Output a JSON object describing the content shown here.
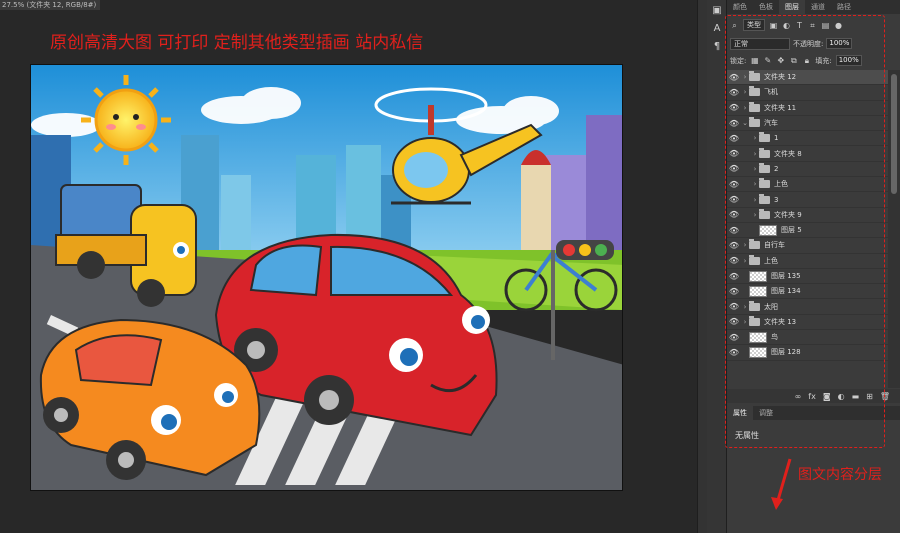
{
  "document": {
    "tab_title": "27.5% (文件夹 12, RGB/8#)"
  },
  "canvas": {
    "headline": "原创高清大图 可打印  定制其他类型插画 站内私信"
  },
  "panel": {
    "tabs": [
      "颜色",
      "色板",
      "图层",
      "通道",
      "路径"
    ],
    "active_tab": "图层",
    "filter": {
      "kind_label": "类型"
    },
    "blend": {
      "mode": "正常",
      "opacity_label": "不透明度:",
      "opacity_value": "100%"
    },
    "lock": {
      "label": "锁定:",
      "fill_label": "填充:",
      "fill_value": "100%"
    },
    "layers": [
      {
        "name": "文件夹 12",
        "type": "folder",
        "indent": 0,
        "selected": true
      },
      {
        "name": "飞机",
        "type": "folder",
        "indent": 0
      },
      {
        "name": "文件夹 11",
        "type": "folder",
        "indent": 0
      },
      {
        "name": "汽车",
        "type": "folder",
        "indent": 0,
        "open": true
      },
      {
        "name": "1",
        "type": "folder",
        "indent": 1
      },
      {
        "name": "文件夹 8",
        "type": "folder",
        "indent": 1
      },
      {
        "name": "2",
        "type": "folder",
        "indent": 1
      },
      {
        "name": "上色",
        "type": "folder",
        "indent": 1
      },
      {
        "name": "3",
        "type": "folder",
        "indent": 1
      },
      {
        "name": "文件夹 9",
        "type": "folder",
        "indent": 1
      },
      {
        "name": "图层 5",
        "type": "layer",
        "indent": 1
      },
      {
        "name": "自行车",
        "type": "folder",
        "indent": 0
      },
      {
        "name": "上色",
        "type": "folder",
        "indent": 0
      },
      {
        "name": "图层 135",
        "type": "layer",
        "indent": 0
      },
      {
        "name": "图层 134",
        "type": "layer",
        "indent": 0
      },
      {
        "name": "太阳",
        "type": "folder",
        "indent": 0
      },
      {
        "name": "文件夹 13",
        "type": "folder",
        "indent": 0
      },
      {
        "name": "鸟",
        "type": "layer",
        "indent": 0
      },
      {
        "name": "图层 128",
        "type": "layer",
        "indent": 0
      }
    ],
    "properties": {
      "tabs": [
        "属性",
        "调整"
      ],
      "empty_text": "无属性"
    }
  },
  "annotation": {
    "text": "图文内容分层"
  },
  "colors": {
    "accent_red": "#e0201c",
    "panel_bg": "#3b3b3b",
    "workspace_bg": "#282828"
  },
  "icons": {
    "eye": "eye-icon",
    "folder": "folder-icon",
    "chevron": "chevron-right-icon",
    "lock": "lock-icon",
    "fx": "fx-icon",
    "mask": "mask-icon",
    "new_layer": "new-layer-icon",
    "trash": "trash-icon"
  }
}
